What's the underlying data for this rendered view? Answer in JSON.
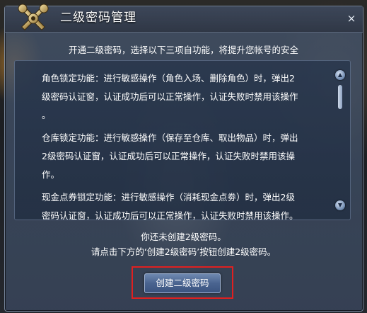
{
  "window": {
    "title": "二级密码管理",
    "close_glyph": "×",
    "emblem_icon": "crossed-keys-icon"
  },
  "intro": "开通二级密码，选择以下三项自功能，将提升您帐号的安全",
  "features": [
    {
      "line1": "角色锁定功能：进行敏感操作（角色入场、删除角色）时，弹出2",
      "line2": "级密码认证窗，认证成功后可以正常操作，认证失败时禁用该操作",
      "line3": "。"
    },
    {
      "line1": "仓库锁定功能：进行敏感操作（保存至仓库、取出物品）时，弹出",
      "line2": "2级密码认证窗，认证成功后可以正常操作，认证失败时禁用该操",
      "line3": "作。"
    },
    {
      "line1": "现金点券锁定功能：进行敏感操作（消耗现金点劵）时，弹出2级",
      "line2": "密码认证窗，认证成功后可以正常操作，认证失败时禁用该操作。"
    }
  ],
  "notice": {
    "line1": "你还未创建2级密码。",
    "line2": "请点击下方的‘创建2级密码’按钮创建2级密码。"
  },
  "create_button_label": "创建二级密码",
  "scrollbar": {
    "up_glyph": "▲",
    "down_glyph": "▼"
  },
  "colors": {
    "highlight_border": "#e02020",
    "panel": "#3a4a62",
    "button": "#4a6490"
  }
}
